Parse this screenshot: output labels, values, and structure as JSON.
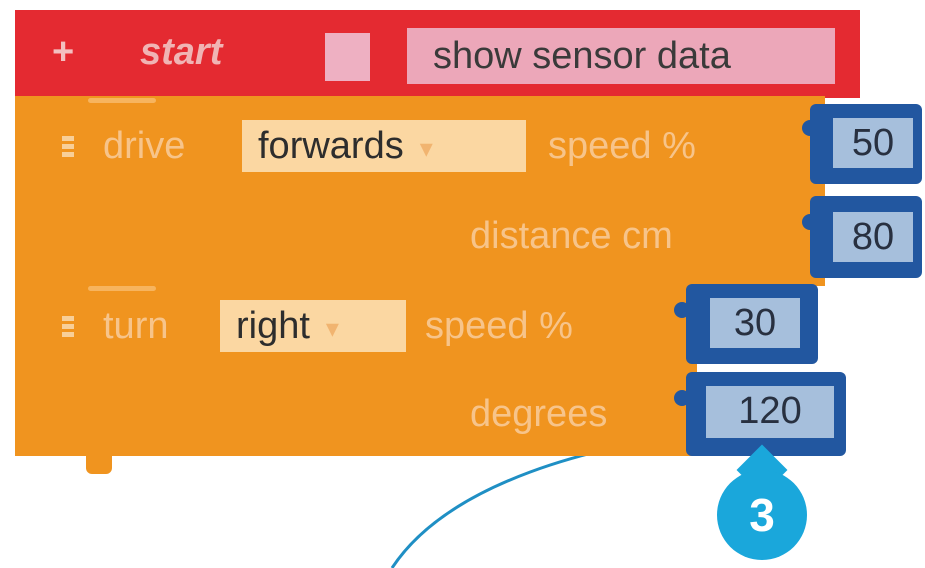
{
  "start_block": {
    "plus_symbol": "+",
    "label": "start",
    "sensor_field": "show sensor data"
  },
  "drive_block": {
    "label": "drive",
    "direction": "forwards",
    "speed_label": "speed %",
    "speed_value": "50",
    "distance_label": "distance cm",
    "distance_value": "80"
  },
  "turn_block": {
    "label": "turn",
    "direction": "right",
    "speed_label": "speed %",
    "speed_value": "30",
    "degrees_label": "degrees",
    "degrees_value": "120"
  },
  "callout": {
    "number": "3"
  },
  "colors": {
    "start_block": "#e42a31",
    "action_block": "#f0941f",
    "value_block": "#2257a0",
    "callout": "#1aa7db"
  },
  "icons": [
    "plus-icon",
    "drag-handle-icon",
    "chevron-down-icon",
    "checkbox-icon"
  ]
}
